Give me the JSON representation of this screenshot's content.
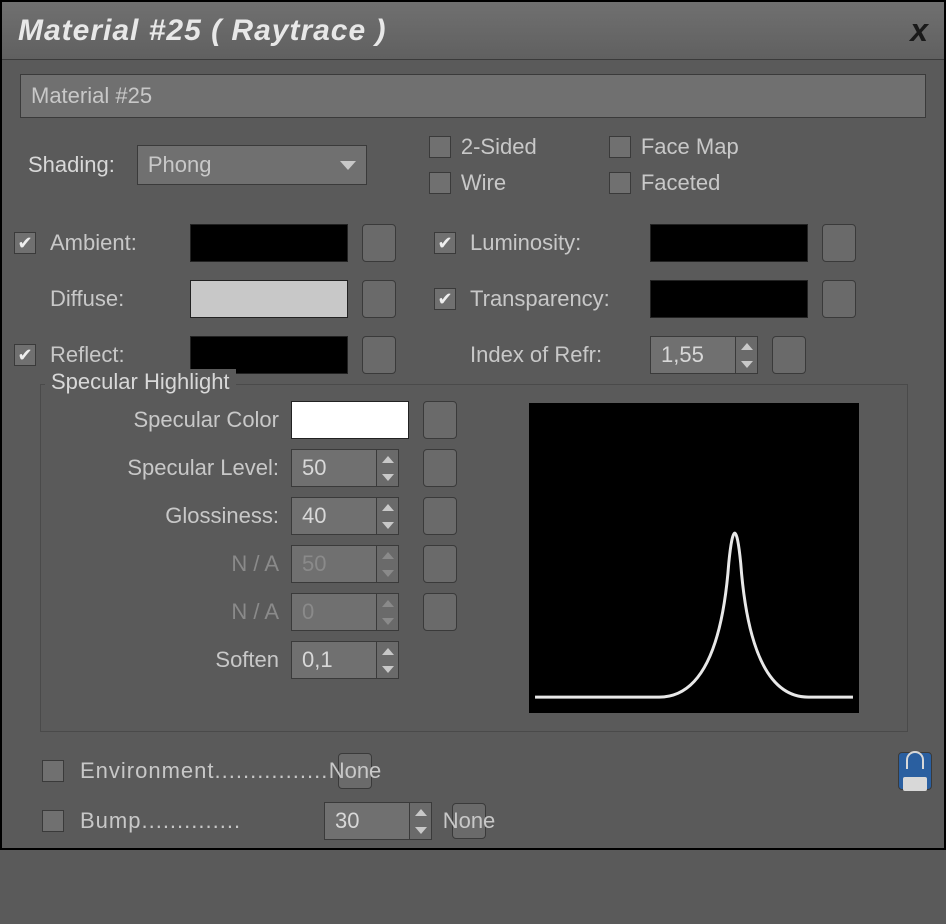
{
  "window": {
    "title": "Material #25  ( Raytrace )"
  },
  "materialName": "Material #25",
  "shading": {
    "label": "Shading:",
    "value": "Phong"
  },
  "options": {
    "twoSided": {
      "label": "2-Sided",
      "checked": false
    },
    "wire": {
      "label": "Wire",
      "checked": false
    },
    "faceMap": {
      "label": "Face Map",
      "checked": false
    },
    "faceted": {
      "label": "Faceted",
      "checked": false
    }
  },
  "colors": {
    "ambient": {
      "label": "Ambient:",
      "checked": true,
      "color": "#000000"
    },
    "diffuse": {
      "label": "Diffuse:",
      "checked": null,
      "color": "#c8c8c8"
    },
    "reflect": {
      "label": "Reflect:",
      "checked": true,
      "color": "#000000"
    },
    "luminosity": {
      "label": "Luminosity:",
      "checked": true,
      "color": "#000000"
    },
    "transparency": {
      "label": "Transparency:",
      "checked": true,
      "color": "#000000"
    },
    "ior": {
      "label": "Index of Refr:",
      "value": "1,55"
    }
  },
  "specular": {
    "legend": "Specular Highlight",
    "color": {
      "label": "Specular Color",
      "value": "#ffffff"
    },
    "level": {
      "label": "Specular Level:",
      "value": "50"
    },
    "gloss": {
      "label": "Glossiness:",
      "value": "40"
    },
    "na1": {
      "label": "N / A",
      "value": "50"
    },
    "na2": {
      "label": "N / A",
      "value": "0"
    },
    "soften": {
      "label": "Soften",
      "value": "0,1"
    }
  },
  "maps": {
    "environment": {
      "label": "Environment",
      "value": "None"
    },
    "bump": {
      "label": "Bump",
      "amount": "30",
      "value": "None"
    }
  }
}
